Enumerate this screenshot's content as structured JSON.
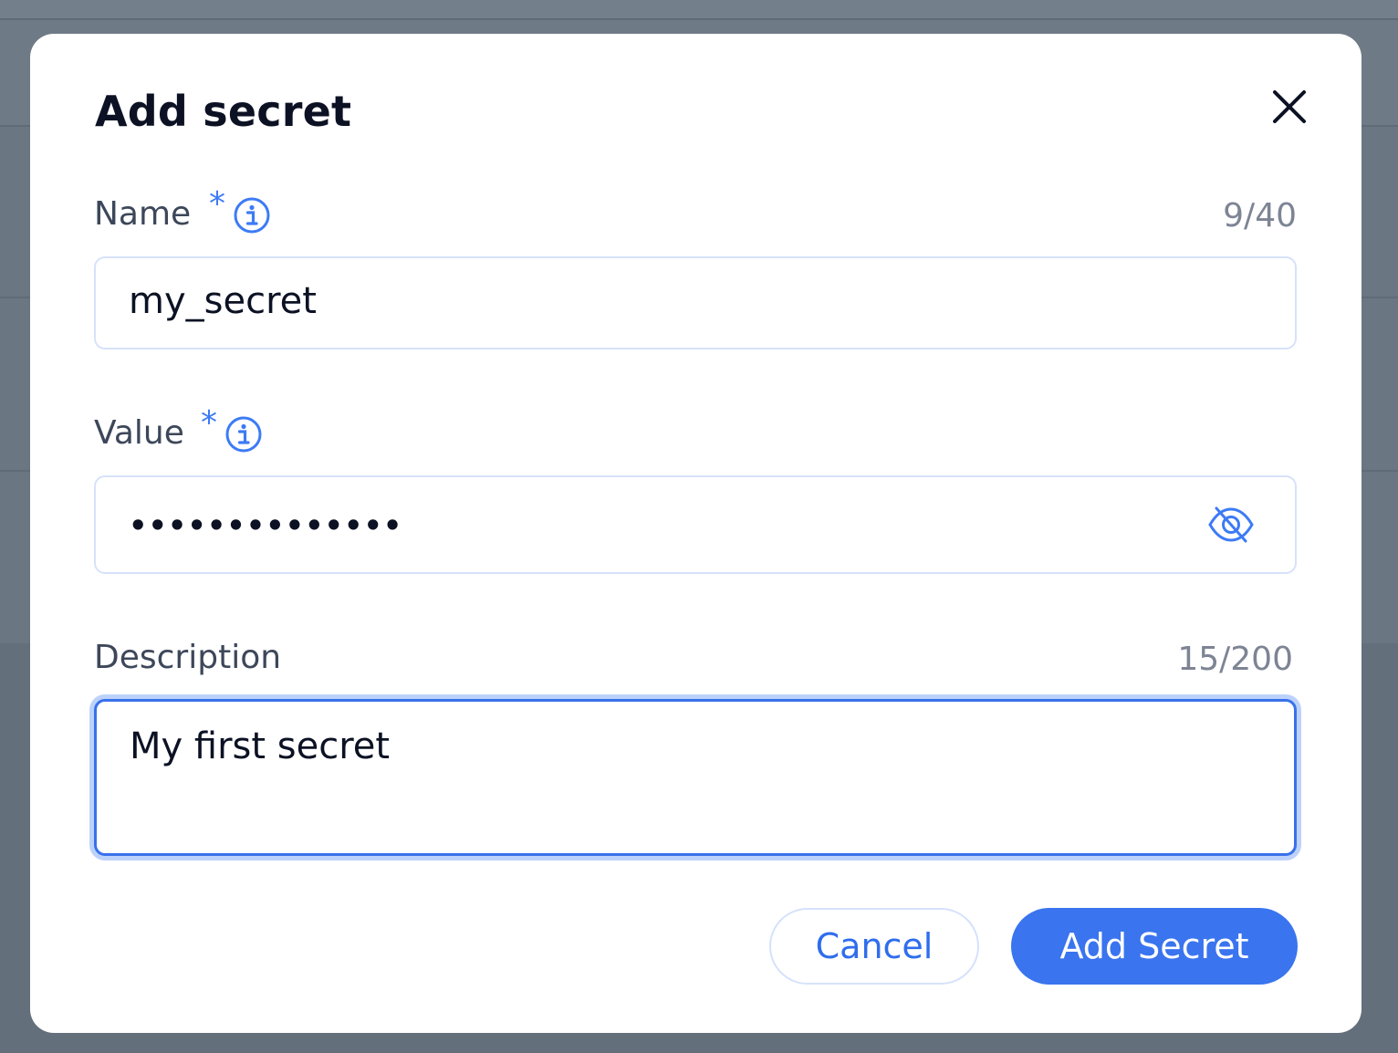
{
  "dialog": {
    "title": "Add secret",
    "close_icon": "close-icon"
  },
  "fields": {
    "name": {
      "label": "Name",
      "required_mark": "*",
      "counter": "9/40",
      "value": "my_secret",
      "info_icon": "info-icon"
    },
    "value": {
      "label": "Value",
      "required_mark": "*",
      "masked_value": "••••••••••••••",
      "info_icon": "info-icon",
      "visibility_icon": "eye-off-icon"
    },
    "description": {
      "label": "Description",
      "counter": "15/200",
      "value": "My first secret"
    }
  },
  "actions": {
    "cancel_label": "Cancel",
    "submit_label": "Add Secret"
  },
  "colors": {
    "accent": "#3a74ef",
    "focus_border": "#3871ea",
    "focus_ring": "#bcd2fb",
    "title_text": "#0c1224",
    "label_text": "#3d475a",
    "counter_text": "#7d8494",
    "overlay": "#6a7682"
  }
}
